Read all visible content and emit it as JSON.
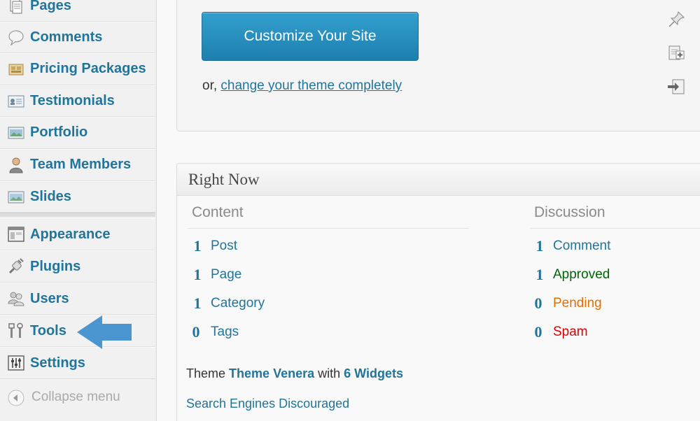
{
  "sidebar": {
    "items": [
      {
        "label": "Pages",
        "icon": "pages-icon"
      },
      {
        "label": "Comments",
        "icon": "comments-icon"
      },
      {
        "label": "Pricing Packages",
        "icon": "pricing-packages-icon"
      },
      {
        "label": "Testimonials",
        "icon": "testimonials-icon"
      },
      {
        "label": "Portfolio",
        "icon": "portfolio-icon"
      },
      {
        "label": "Team Members",
        "icon": "team-members-icon"
      },
      {
        "label": "Slides",
        "icon": "slides-icon"
      },
      {
        "label": "Appearance",
        "icon": "appearance-icon"
      },
      {
        "label": "Plugins",
        "icon": "plugins-icon"
      },
      {
        "label": "Users",
        "icon": "users-icon"
      },
      {
        "label": "Tools",
        "icon": "tools-icon"
      },
      {
        "label": "Settings",
        "icon": "settings-icon"
      }
    ],
    "collapse_label": "Collapse menu",
    "callout_icon": "blue-arrow-left-icon"
  },
  "welcome": {
    "customize_label": "Customize Your Site",
    "or_text": "or,",
    "change_theme_link": "change your theme completely",
    "tools": [
      "pin-icon",
      "add-widget-icon",
      "login-icon"
    ]
  },
  "right_now": {
    "title": "Right Now",
    "content_heading": "Content",
    "discussion_heading": "Discussion",
    "content": [
      {
        "count": "1",
        "label": "Post"
      },
      {
        "count": "1",
        "label": "Page"
      },
      {
        "count": "1",
        "label": "Category"
      },
      {
        "count": "0",
        "label": "Tags"
      }
    ],
    "discussion": [
      {
        "count": "1",
        "label": "Comment",
        "color": "#21759b"
      },
      {
        "count": "1",
        "label": "Approved",
        "color": "#006505"
      },
      {
        "count": "0",
        "label": "Pending",
        "color": "#e66f00"
      },
      {
        "count": "0",
        "label": "Spam",
        "color": "#dd0000"
      }
    ],
    "theme_prefix": "Theme",
    "theme_name": "Theme Venera",
    "theme_with": "with",
    "widgets_link": "6 Widgets",
    "search_engines": "Search Engines Discouraged"
  },
  "colors": {
    "link": "#21759b",
    "button": "#2a8fc1",
    "arrow": "#4b96d1"
  }
}
